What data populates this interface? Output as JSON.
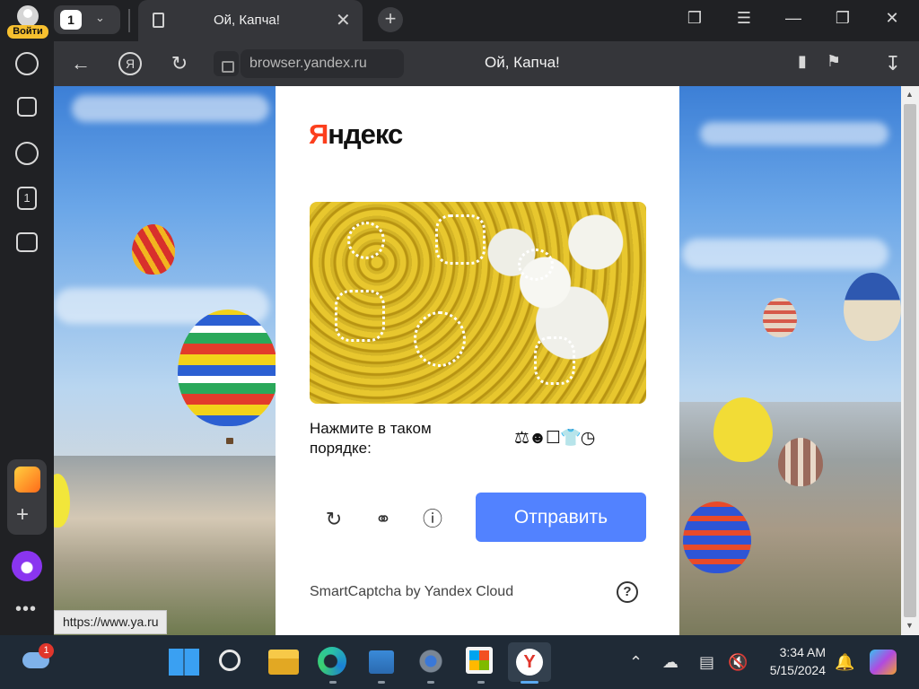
{
  "profile": {
    "login_label": "Войти"
  },
  "tabs": {
    "count": "1",
    "active_title": "Ой, Капча!"
  },
  "navbar": {
    "url": "browser.yandex.ru",
    "page_title": "Ой, Капча!"
  },
  "captcha": {
    "logo_first": "Я",
    "logo_rest": "ндекс",
    "instruction": "Нажмите в таком порядке:",
    "order_icons": "⚖︎☻☐👕◷",
    "submit_label": "Отправить",
    "footer": "SmartCaptcha by Yandex Cloud",
    "help_label": "?"
  },
  "status_bar": {
    "url": "https://www.ya.ru"
  },
  "taskbar": {
    "weather_badge": "1",
    "time": "3:34 AM",
    "date": "5/15/2024"
  },
  "colors": {
    "submit": "#5282ff",
    "yandex_red": "#fc3f1d",
    "login_badge": "#f7c02f"
  }
}
